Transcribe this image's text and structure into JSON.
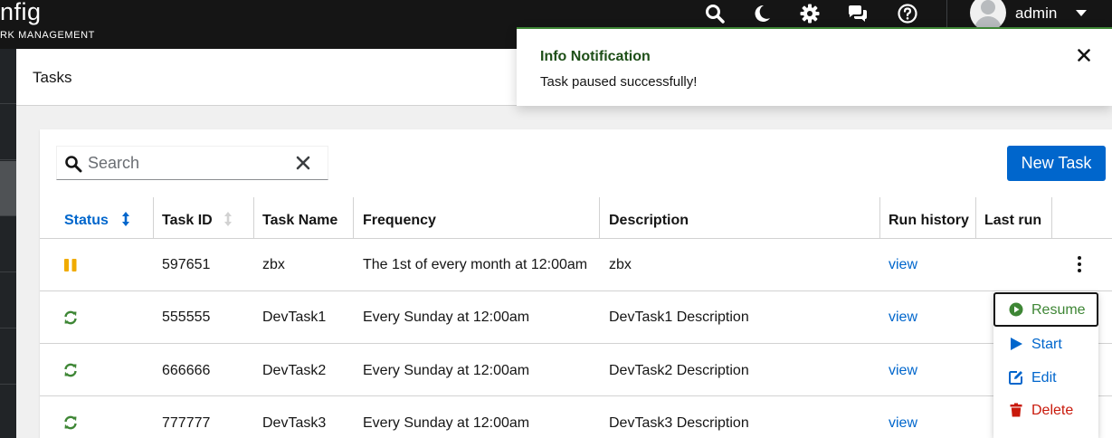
{
  "brand": {
    "name": "nfig",
    "tagline": "RK MANAGEMENT"
  },
  "masthead": {
    "icons": [
      "search-icon",
      "moon-icon",
      "gear-icon",
      "comments-icon",
      "help-icon"
    ],
    "user": {
      "name": "admin"
    }
  },
  "page": {
    "title": "Tasks"
  },
  "toolbar": {
    "search_placeholder": "Search",
    "new_task_label": "New Task"
  },
  "table": {
    "columns": [
      "Status",
      "Task ID",
      "Task Name",
      "Frequency",
      "Description",
      "Run history",
      "Last run"
    ],
    "sorted_column": "Status",
    "rows": [
      {
        "status": "paused",
        "task_id": "597651",
        "task_name": "zbx",
        "frequency": "The 1st of every month at 12:00am",
        "description": "zbx",
        "run_history": "view",
        "last_run": ""
      },
      {
        "status": "active",
        "task_id": "555555",
        "task_name": "DevTask1",
        "frequency": "Every Sunday at 12:00am",
        "description": "DevTask1 Description",
        "run_history": "view",
        "last_run": ""
      },
      {
        "status": "active",
        "task_id": "666666",
        "task_name": "DevTask2",
        "frequency": "Every Sunday at 12:00am",
        "description": "DevTask2 Description",
        "run_history": "view",
        "last_run": ""
      },
      {
        "status": "active",
        "task_id": "777777",
        "task_name": "DevTask3",
        "frequency": "Every Sunday at 12:00am",
        "description": "DevTask3 Description",
        "run_history": "view",
        "last_run": ""
      }
    ]
  },
  "row_menu": {
    "items": [
      {
        "label": "Resume",
        "icon": "play-circle-icon",
        "color": "#3e8635"
      },
      {
        "label": "Start",
        "icon": "play-icon",
        "color": "#0066cc"
      },
      {
        "label": "Edit",
        "icon": "edit-icon",
        "color": "#0066cc"
      },
      {
        "label": "Delete",
        "icon": "trash-icon",
        "color": "#c9190b"
      }
    ]
  },
  "notification": {
    "title": "Info Notification",
    "message": "Task paused successfully!"
  },
  "colors": {
    "primary": "#0066cc",
    "success": "#3e8635",
    "paused": "#f0ab00",
    "danger": "#c9190b",
    "masthead": "#151515"
  }
}
